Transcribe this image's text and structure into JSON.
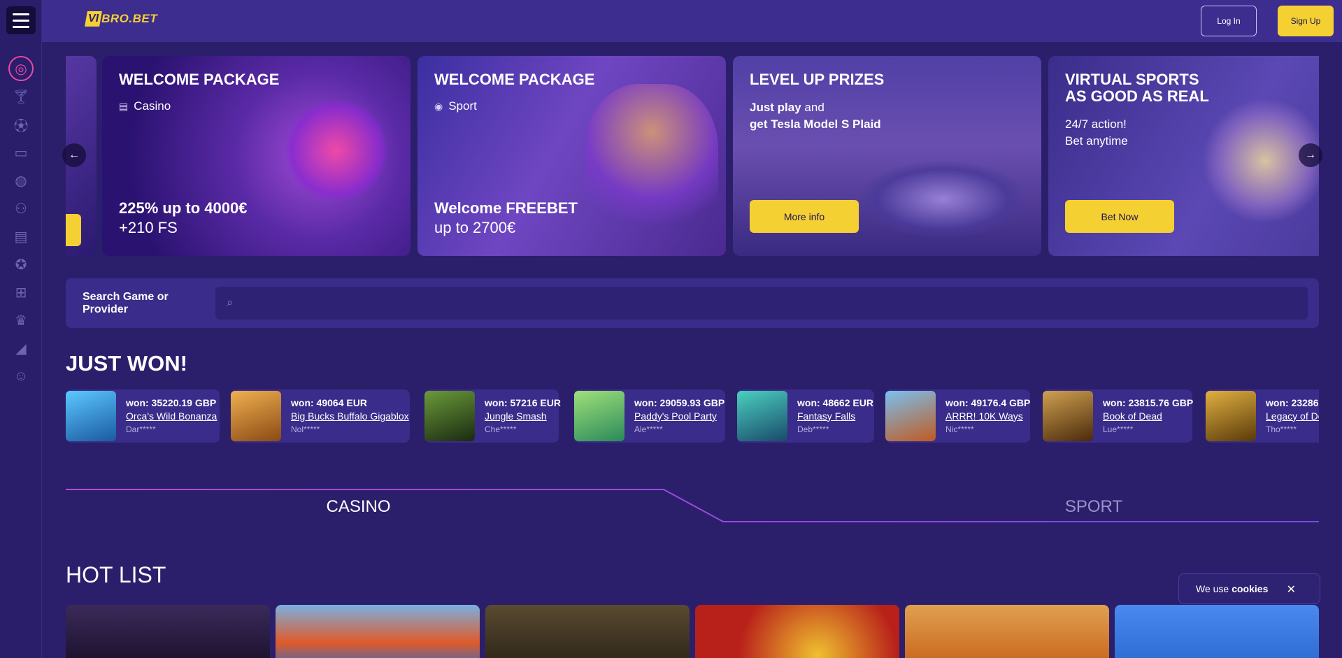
{
  "header": {
    "logo_mark": "VI",
    "logo_text": "BRO.BET",
    "login_label": "Log In",
    "signup_label": "Sign Up"
  },
  "sidebar": {
    "icons": [
      "target-icon",
      "cocktail-icon",
      "football-icon",
      "tv-icon",
      "basketball-icon",
      "balls-icon",
      "cards-icon",
      "soccer-icon",
      "gift-icon",
      "crown-icon",
      "megaphone-icon",
      "support-icon"
    ]
  },
  "banners": [
    {
      "title": "WELCOME PACKAGE",
      "tag": "Casino",
      "bottom_line1": "225% up to 4000€",
      "bottom_line2": "+210 FS"
    },
    {
      "title": "WELCOME PACKAGE",
      "tag": "Sport",
      "bottom_line1": "Welcome FREEBET",
      "bottom_line2": "up to 2700€"
    },
    {
      "title": "LEVEL UP PRIZES",
      "text_bold1": "Just play",
      "text_normal1": " and",
      "text_bold2": "get Tesla Model S Plaid",
      "button": "More info"
    },
    {
      "title_line1": "VIRTUAL SPORTS",
      "title_line2": "AS GOOD AS REAL",
      "text_line1": "24/7 action!",
      "text_line2": "Bet anytime",
      "button": "Bet Now"
    }
  ],
  "carousel": {
    "prev_arrow": "←",
    "next_arrow": "→"
  },
  "search": {
    "label": "Search Game or Provider",
    "placeholder": ""
  },
  "just_won": {
    "title": "JUST WON!",
    "items": [
      {
        "amount": "won: 35220.19 GBP",
        "game": "Orca's Wild Bonanza",
        "user": "Dar*****",
        "thumb_color": "#2a8fcf"
      },
      {
        "amount": "won: 49064 EUR",
        "game": "Big Bucks Buffalo Gigablox",
        "user": "Nol*****",
        "thumb_color": "#c8782a"
      },
      {
        "amount": "won: 57216 EUR",
        "game": "Jungle Smash",
        "user": "Che*****",
        "thumb_color": "#3a5a2a"
      },
      {
        "amount": "won: 29059.93 GBP",
        "game": "Paddy's Pool Party",
        "user": "Ale*****",
        "thumb_color": "#4fb06a"
      },
      {
        "amount": "won: 48662 EUR",
        "game": "Fantasy Falls",
        "user": "Deb*****",
        "thumb_color": "#2a9a8a"
      },
      {
        "amount": "won: 49176.4 GBP",
        "game": "ARRR! 10K Ways",
        "user": "Nic*****",
        "thumb_color": "#3a8fd0"
      },
      {
        "amount": "won: 23815.76 GBP",
        "game": "Book of Dead",
        "user": "Lue*****",
        "thumb_color": "#8a5a1a"
      },
      {
        "amount": "won: 23286",
        "game": "Legacy of De",
        "user": "Tho*****",
        "thumb_color": "#6a4a12"
      }
    ]
  },
  "tabs": {
    "casino": "CASINO",
    "sport": "SPORT"
  },
  "hot_list": {
    "title": "HOT LIST",
    "card_colors": [
      "#1a0f2a",
      "#3a6ab8",
      "#2a2418",
      "#b8201a",
      "#c8621a",
      "#2a6ad0"
    ]
  },
  "cookie": {
    "text": "We use",
    "link": "cookies",
    "close": "✕"
  },
  "colors": {
    "accent": "#f5d033",
    "background": "#2b1f6b",
    "card": "#3a2c8a",
    "active_icon": "#e64aa6"
  }
}
